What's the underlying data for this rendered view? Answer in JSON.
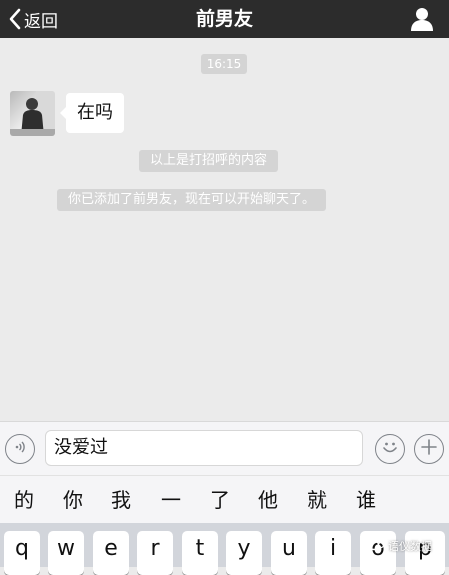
{
  "nav": {
    "back_label": "返回",
    "title": "前男友"
  },
  "chat": {
    "time": "16:15",
    "messages": [
      {
        "from": "contact",
        "text": "在吗"
      }
    ],
    "system": [
      "以上是打招呼的内容",
      "你已添加了前男友，现在可以开始聊天了。"
    ]
  },
  "input": {
    "value": "没爱过"
  },
  "candidates": [
    "的",
    "你",
    "我",
    "一",
    "了",
    "他",
    "就",
    "谁"
  ],
  "keyboard": {
    "row1": [
      "q",
      "w",
      "e",
      "r",
      "t",
      "y",
      "u",
      "i",
      "o",
      "p"
    ]
  },
  "watermark": "语仪数据",
  "colors": {
    "nav_bg": "#2c2c2c",
    "chat_bg": "#ebebeb",
    "system_pill_bg": "#d4d4d4",
    "keyboard_bg": "#d2d5db"
  },
  "icons": [
    "back-chevron-icon",
    "profile-icon",
    "voice-icon",
    "emoji-icon",
    "plus-icon"
  ]
}
